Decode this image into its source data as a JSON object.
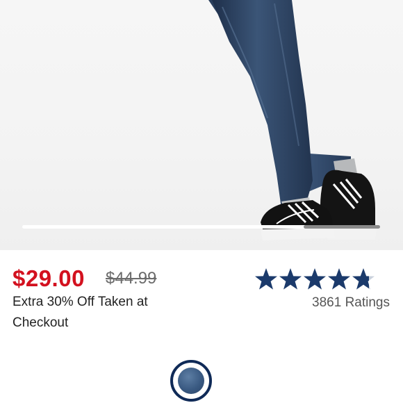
{
  "product": {
    "sale_price": "$29.00",
    "regular_price": "$44.99",
    "promo_text": "Extra 30% Off Taken at Checkout",
    "rating_value": 4.8,
    "rating_count_text": "3861 Ratings"
  },
  "carousel": {
    "current_position": 0.88
  },
  "colors": {
    "sale": "#d3111f",
    "brand_navy": "#0f2a57",
    "star": "#1b3a6b"
  },
  "swatch": {
    "selected": true,
    "icon": "denim-swatch"
  }
}
